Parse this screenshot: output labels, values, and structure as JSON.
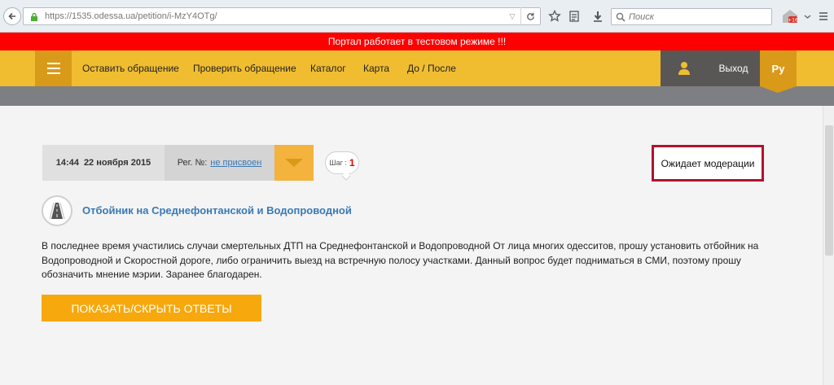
{
  "browser": {
    "url": "https://1535.odessa.ua/petition/i-MzY4OTg/",
    "search_placeholder": "Поиск"
  },
  "banner": {
    "text": "Портал работает в тестовом режиме !!!"
  },
  "nav": {
    "items": [
      "Оставить обращение",
      "Проверить обращение",
      "Каталог",
      "Карта",
      "До / После"
    ],
    "logout": "Выход",
    "lang": "Ру"
  },
  "petition": {
    "time": "14:44",
    "date": "22 ноября 2015",
    "reg_label": "Рег. №:",
    "reg_value": "не присвоен",
    "step_label": "Шаг :",
    "step_value": "1",
    "status": "Ожидает модерации",
    "title": "Отбойник на Среднефонтанской и Водопроводной",
    "body": "В последнее время участились случаи смертельных ДТП на Среднефонтанской и Водопроводной От лица многих одесситов, прошу установить отбойник на Водопроводной и Скоростной дороге, либо ограничить выезд на встречную полосу участками. Данный вопрос будет подниматься в СМИ, поэтому прошу обозначить мнение мэрии. Заранее благодарен.",
    "toggle_button": "ПОКАЗАТЬ/СКРЫТЬ ОТВЕТЫ"
  },
  "colors": {
    "banner": "#ff0000",
    "nav": "#f0bd31",
    "accent": "#d99a1a",
    "button": "#f7a80d",
    "link": "#3a79b5",
    "status_border": "#b0132e"
  }
}
